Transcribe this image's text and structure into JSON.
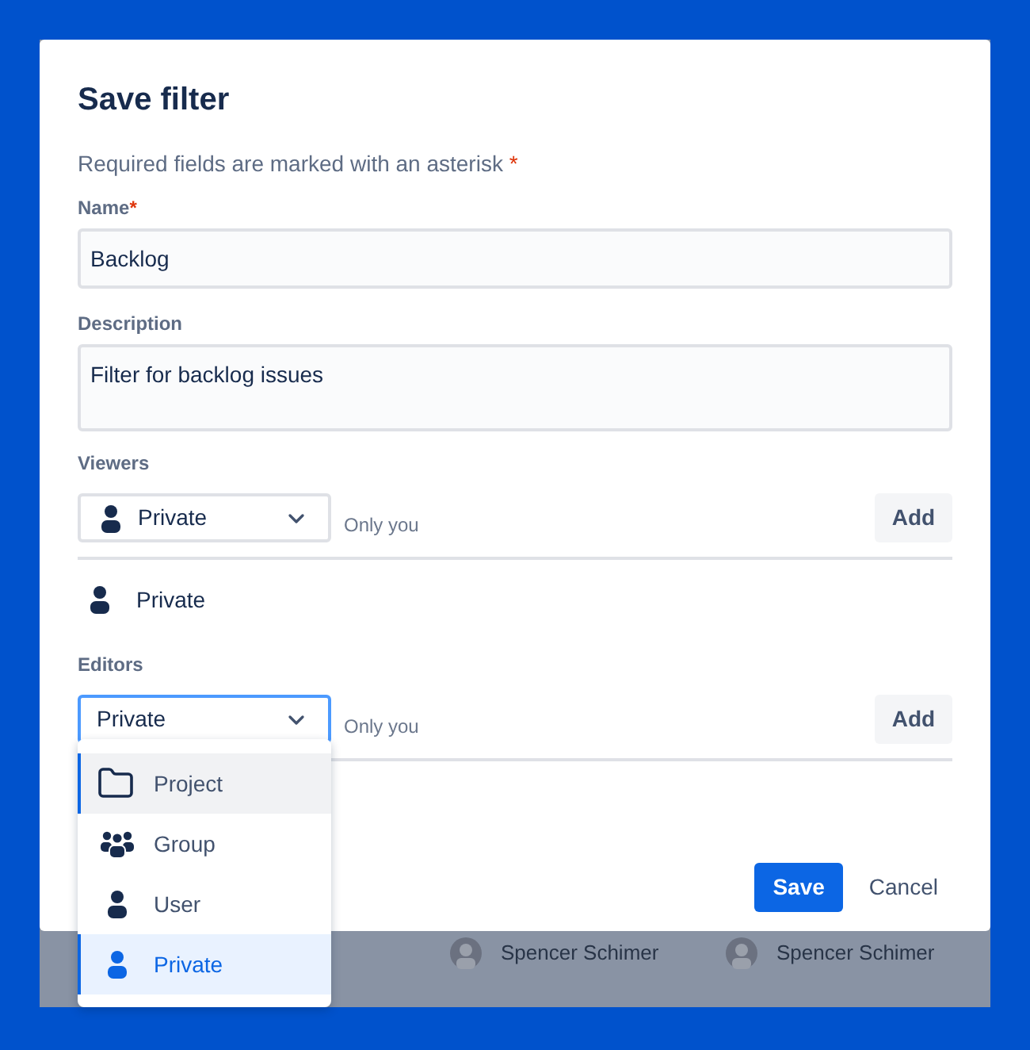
{
  "dialog": {
    "title": "Save filter",
    "required_note": "Required fields are marked with an asterisk",
    "required_mark": "*",
    "name": {
      "label": "Name",
      "required_mark": "*",
      "value": "Backlog"
    },
    "description": {
      "label": "Description",
      "value": "Filter for backlog issues"
    },
    "viewers": {
      "label": "Viewers",
      "select": {
        "value": "Private",
        "has_icon": true,
        "focused": false
      },
      "hint": "Only you",
      "add_button": "Add",
      "entries": [
        {
          "kind": "private",
          "label": "Private"
        }
      ]
    },
    "editors": {
      "label": "Editors",
      "select": {
        "value": "Private",
        "has_icon": false,
        "focused": true
      },
      "hint": "Only you",
      "add_button": "Add"
    },
    "buttons": {
      "save": "Save",
      "cancel": "Cancel"
    }
  },
  "dropdown": [
    {
      "kind": "project",
      "label": "Project",
      "focused": true,
      "selected": false
    },
    {
      "kind": "group",
      "label": "Group",
      "focused": false,
      "selected": false
    },
    {
      "kind": "user",
      "label": "User",
      "focused": false,
      "selected": false
    },
    {
      "kind": "user",
      "label": "Private",
      "focused": false,
      "selected": true
    }
  ],
  "background": {
    "people": [
      {
        "name": "Spencer Schimer"
      },
      {
        "name": "Spencer Schimer"
      }
    ]
  }
}
